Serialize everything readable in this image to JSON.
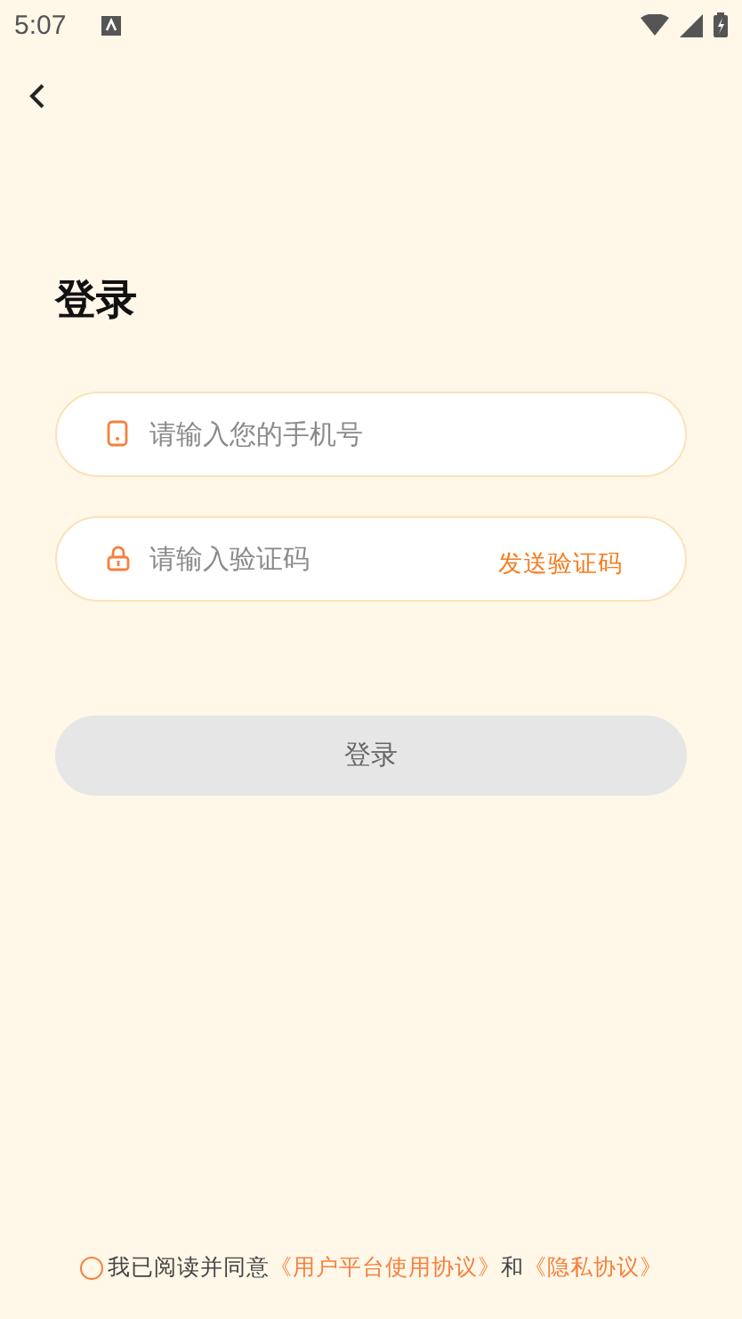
{
  "status_bar": {
    "time": "5:07"
  },
  "title": "登录",
  "phone_field": {
    "placeholder": "请输入您的手机号"
  },
  "code_field": {
    "placeholder": "请输入验证码",
    "send_code": "发送验证码"
  },
  "login_button": {
    "label": "登录",
    "disabled": true
  },
  "agreement": {
    "checked": false,
    "text": "我已阅读并同意",
    "link_1": "《用户平台使用协议》",
    "joiner": "和",
    "link_2": "《隐私协议》"
  }
}
